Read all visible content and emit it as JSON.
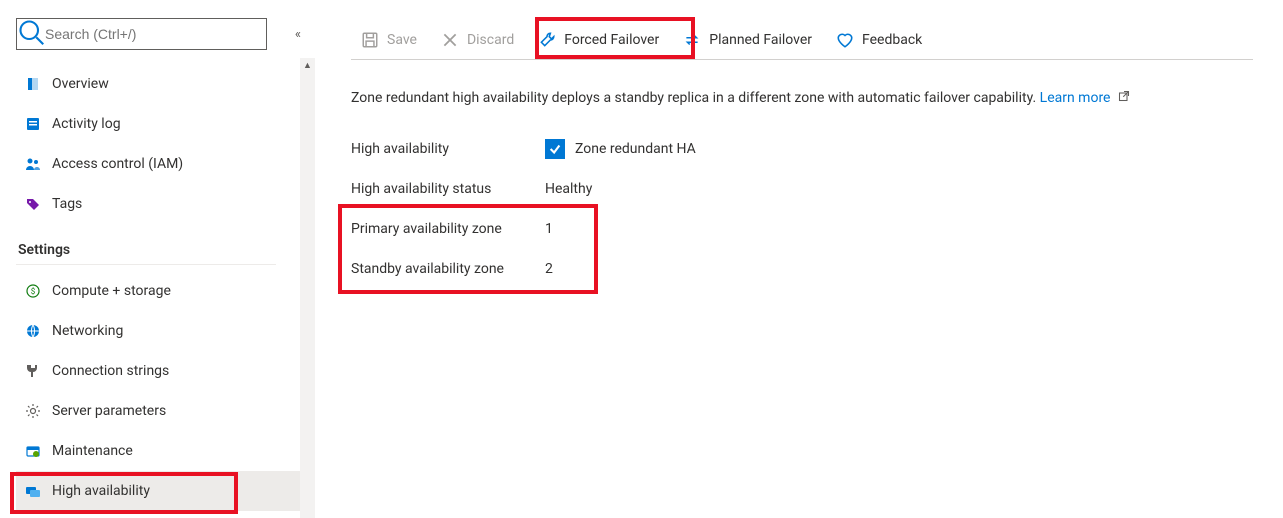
{
  "sidebar": {
    "search_placeholder": "Search (Ctrl+/)",
    "items_top": [
      {
        "id": "overview",
        "label": "Overview",
        "icon": "overview-icon"
      },
      {
        "id": "activity-log",
        "label": "Activity log",
        "icon": "activity-log-icon"
      },
      {
        "id": "access-control",
        "label": "Access control (IAM)",
        "icon": "people-icon"
      },
      {
        "id": "tags",
        "label": "Tags",
        "icon": "tag-icon"
      }
    ],
    "section_settings_label": "Settings",
    "items_settings": [
      {
        "id": "compute-storage",
        "label": "Compute + storage",
        "icon": "compute-icon"
      },
      {
        "id": "networking",
        "label": "Networking",
        "icon": "networking-icon"
      },
      {
        "id": "connection-strings",
        "label": "Connection strings",
        "icon": "plug-icon"
      },
      {
        "id": "server-parameters",
        "label": "Server parameters",
        "icon": "gear-icon"
      },
      {
        "id": "maintenance",
        "label": "Maintenance",
        "icon": "maintenance-icon"
      },
      {
        "id": "high-availability",
        "label": "High availability",
        "icon": "ha-icon",
        "selected": true
      }
    ]
  },
  "toolbar": {
    "save_label": "Save",
    "discard_label": "Discard",
    "forced_failover_label": "Forced Failover",
    "planned_failover_label": "Planned Failover",
    "feedback_label": "Feedback"
  },
  "description_text": "Zone redundant high availability deploys a standby replica in a different zone with automatic failover capability.",
  "learn_more_label": "Learn more",
  "fields": {
    "ha_label": "High availability",
    "ha_checkbox_label": "Zone redundant HA",
    "ha_checked": true,
    "status_label": "High availability status",
    "status_value": "Healthy",
    "primary_zone_label": "Primary availability zone",
    "primary_zone_value": "1",
    "standby_zone_label": "Standby availability zone",
    "standby_zone_value": "2"
  }
}
